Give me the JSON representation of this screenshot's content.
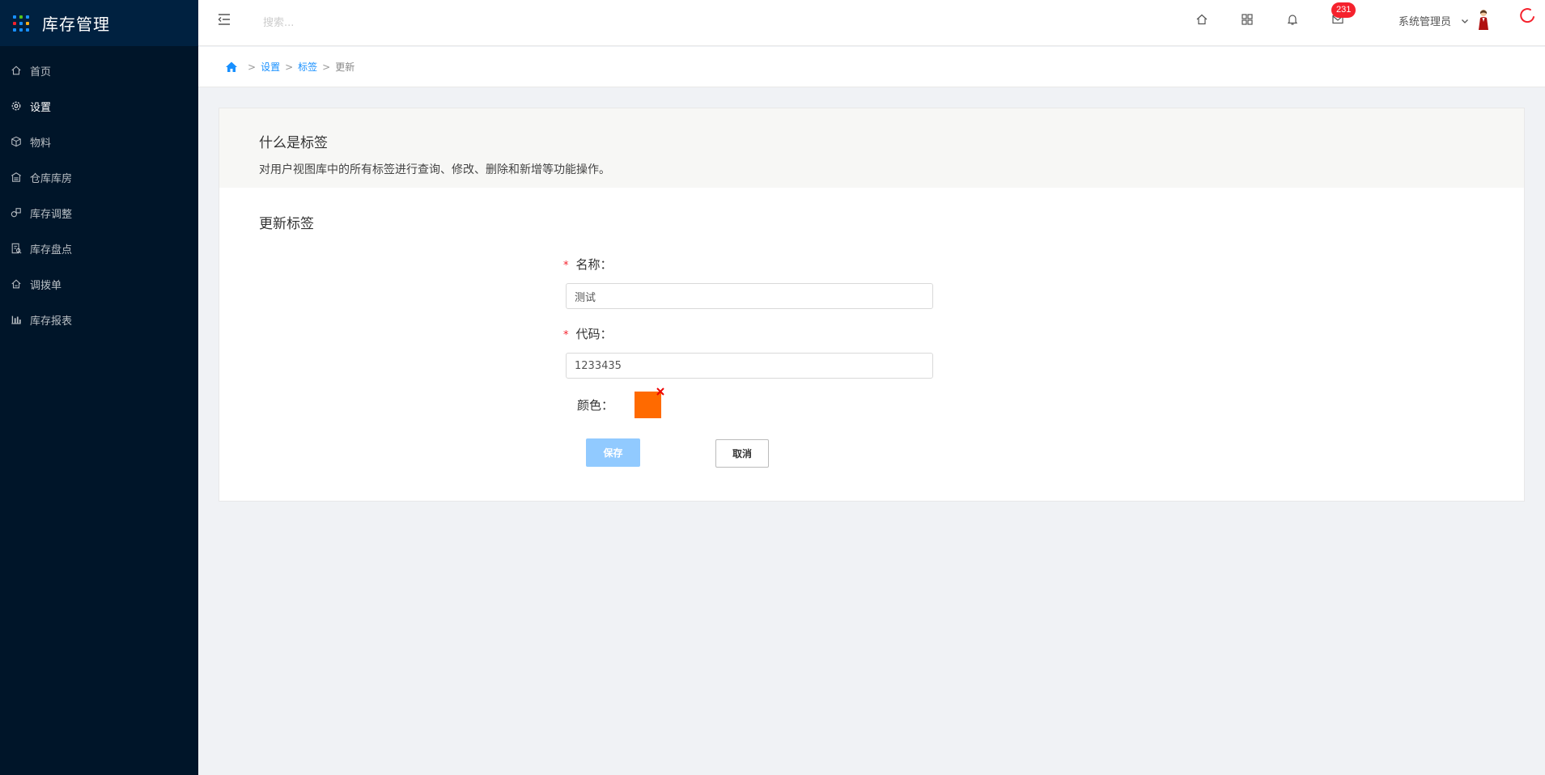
{
  "app": {
    "title": "库存管理"
  },
  "sidebar": {
    "items": [
      {
        "label": "首页",
        "icon": "home-icon",
        "active": false
      },
      {
        "label": "设置",
        "icon": "settings-icon",
        "active": true
      },
      {
        "label": "物料",
        "icon": "box-icon",
        "active": false
      },
      {
        "label": "仓库库房",
        "icon": "warehouse-icon",
        "active": false
      },
      {
        "label": "库存调整",
        "icon": "adjust-icon",
        "active": false
      },
      {
        "label": "库存盘点",
        "icon": "inventory-check-icon",
        "active": false
      },
      {
        "label": "调拨单",
        "icon": "transfer-icon",
        "active": false
      },
      {
        "label": "库存报表",
        "icon": "report-chart-icon",
        "active": false
      }
    ]
  },
  "header": {
    "search_placeholder": "搜索...",
    "badge_count": "231",
    "user_name": "系统管理员"
  },
  "breadcrumb": {
    "items": [
      "设置",
      "标签"
    ],
    "current": "更新",
    "separator": ">"
  },
  "intro": {
    "title": "什么是标签",
    "description": "对用户视图库中的所有标签进行查询、修改、删除和新增等功能操作。"
  },
  "form": {
    "title": "更新标签",
    "name_label": "名称：",
    "name_value": "测试",
    "code_label": "代码：",
    "code_value": "1233435",
    "color_label": "颜色：",
    "color_value": "#ff6a00",
    "required_mark": "*",
    "save_label": "保存",
    "cancel_label": "取消"
  },
  "colors": {
    "sidebar_bg": "#001529",
    "brand_bg": "#002140",
    "primary": "#1890ff",
    "badge": "#f5222d"
  }
}
